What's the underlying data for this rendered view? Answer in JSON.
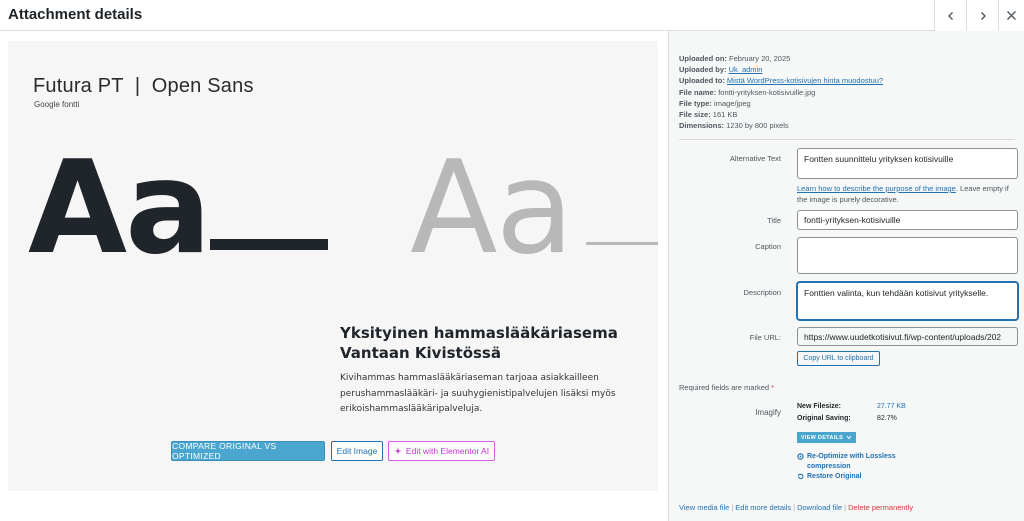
{
  "header": {
    "title": "Attachment details",
    "prev_icon": "chevron-left-icon",
    "next_icon": "chevron-right-icon",
    "close_icon": "close-icon"
  },
  "preview": {
    "fonts_title": "Futura PT  |  Open Sans",
    "google_label": "Google fontti",
    "aa_dark": "Aa",
    "aa_light": "Aa",
    "heading": "Yksityinen hammaslääkäriasema Vantaan Kivistössä",
    "body": "Kivihammas hammaslääkäriaseman tarjoaa asiakkailleen perushammaslääkäri- ja suuhygienistipalvelujen lisäksi myös erikoishammaslääkäripalveluja."
  },
  "buttons": {
    "compare": "COMPARE ORIGINAL VS OPTIMIZED",
    "edit_image": "Edit Image",
    "elementor": "Edit with Elementor AI"
  },
  "meta": {
    "uploaded_on_label": "Uploaded on:",
    "uploaded_on": "February 20, 2025",
    "uploaded_by_label": "Uploaded by:",
    "uploaded_by": "Uk_admin",
    "uploaded_to_label": "Uploaded to:",
    "uploaded_to": "Mistä WordPress-kotisivujen hinta muodostuu?",
    "file_name_label": "File name:",
    "file_name": "fontti-yrityksen-kotisivuille.jpg",
    "file_type_label": "File type:",
    "file_type": "image/jpeg",
    "file_size_label": "File size:",
    "file_size": "161 KB",
    "dimensions_label": "Dimensions:",
    "dimensions": "1230 by 800 pixels"
  },
  "form": {
    "alt_label": "Alternative Text",
    "alt_value": "Fontten suunnittelu yrityksen kotisivuille",
    "alt_help_link": "Learn how to describe the purpose of the image",
    "alt_help_rest": ". Leave empty if the image is purely decorative.",
    "title_label": "Title",
    "title_value": "fontti-yrityksen-kotisivuille",
    "caption_label": "Caption",
    "caption_value": "",
    "description_label": "Description",
    "description_value": "Fonttien valinta, kun tehdään kotisivut yritykselle.",
    "file_url_label": "File URL:",
    "file_url_value": "https://www.uudetkotisivut.fi/wp-content/uploads/202",
    "copy_url": "Copy URL to clipboard",
    "required_text": "Required fields are marked",
    "required_star": "*"
  },
  "imagify": {
    "label": "Imagify",
    "new_filesize_label": "New Filesize:",
    "new_filesize": "27.77 KB",
    "original_saving_label": "Original Saving:",
    "original_saving": "82.7%",
    "view_details": "VIEW DETAILS",
    "reoptimize": "Re-Optimize with Lossless compression",
    "restore": "Restore Original"
  },
  "footer": {
    "view_media": "View media file",
    "edit_more": "Edit more details",
    "download": "Download file",
    "delete": "Delete permanently",
    "separator": "|"
  },
  "colors": {
    "accent": "#2271b1",
    "imagify_blue": "#4aa6cf",
    "danger": "#d63638",
    "elementor_pink": "#c233c9"
  }
}
